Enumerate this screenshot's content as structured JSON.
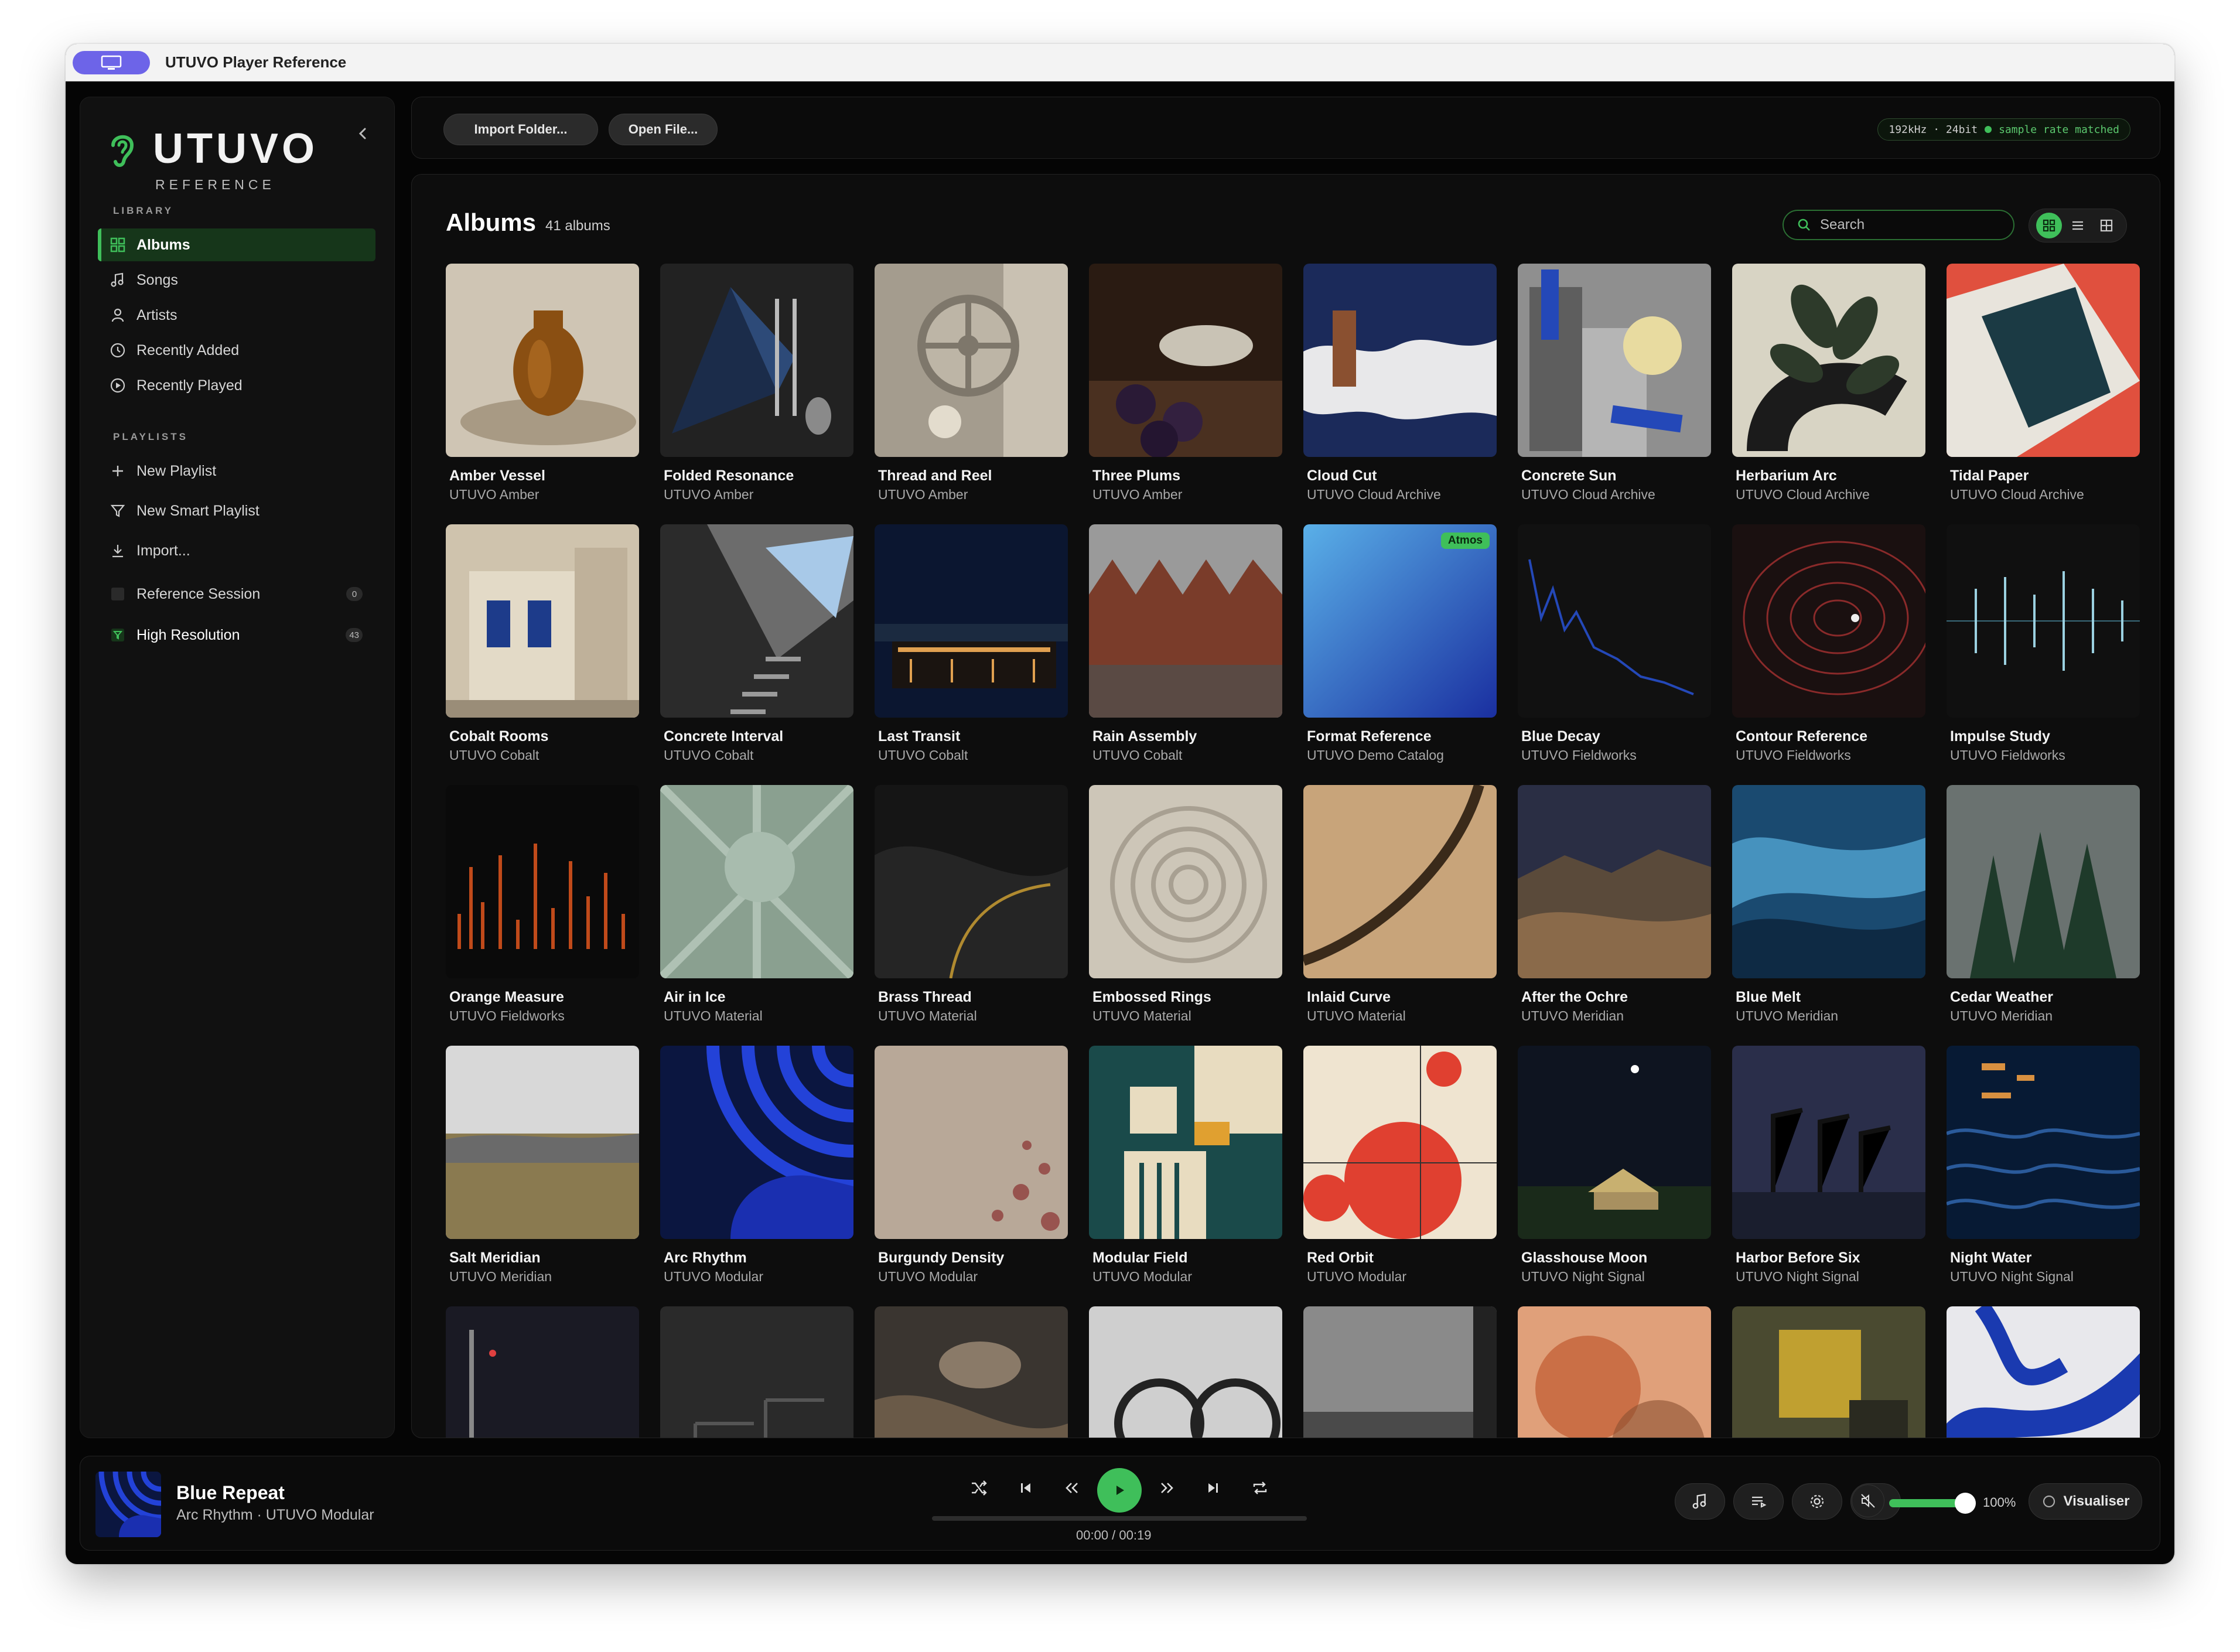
{
  "window": {
    "title": "UTUVO Player Reference"
  },
  "sidebar": {
    "logo_name": "UTUVO",
    "logo_sub": "REFERENCE",
    "library_label": "LIBRARY",
    "library": [
      {
        "label": "Albums",
        "icon": "grid-icon"
      },
      {
        "label": "Songs",
        "icon": "music-note-icon"
      },
      {
        "label": "Artists",
        "icon": "person-icon"
      },
      {
        "label": "Recently Added",
        "icon": "clock-icon"
      },
      {
        "label": "Recently Played",
        "icon": "play-circle-icon"
      }
    ],
    "playlists_label": "PLAYLISTS",
    "playlist_actions": [
      {
        "label": "New Playlist",
        "icon": "plus-icon"
      },
      {
        "label": "New Smart Playlist",
        "icon": "filter-icon"
      },
      {
        "label": "Import...",
        "icon": "download-icon"
      }
    ],
    "playlists": [
      {
        "label": "Reference Session",
        "count": "0"
      },
      {
        "label": "High Resolution",
        "count": "43"
      }
    ]
  },
  "toolbar": {
    "import_folder": "Import Folder...",
    "open_file": "Open File...",
    "rate": "192kHz · 24bit",
    "rate_status": "sample rate matched"
  },
  "albums_view": {
    "title": "Albums",
    "count": "41 albums",
    "search_placeholder": "Search",
    "badge_atmos": "Atmos",
    "albums": [
      {
        "title": "Amber Vessel",
        "artist": "UTUVO Amber"
      },
      {
        "title": "Folded Resonance",
        "artist": "UTUVO Amber"
      },
      {
        "title": "Thread and Reel",
        "artist": "UTUVO Amber"
      },
      {
        "title": "Three Plums",
        "artist": "UTUVO Amber"
      },
      {
        "title": "Cloud Cut",
        "artist": "UTUVO Cloud Archive"
      },
      {
        "title": "Concrete Sun",
        "artist": "UTUVO Cloud Archive"
      },
      {
        "title": "Herbarium Arc",
        "artist": "UTUVO Cloud Archive"
      },
      {
        "title": "Tidal Paper",
        "artist": "UTUVO Cloud Archive"
      },
      {
        "title": "Cobalt Rooms",
        "artist": "UTUVO Cobalt"
      },
      {
        "title": "Concrete Interval",
        "artist": "UTUVO Cobalt"
      },
      {
        "title": "Last Transit",
        "artist": "UTUVO Cobalt"
      },
      {
        "title": "Rain Assembly",
        "artist": "UTUVO Cobalt"
      },
      {
        "title": "Format Reference",
        "artist": "UTUVO Demo Catalog"
      },
      {
        "title": "Blue Decay",
        "artist": "UTUVO Fieldworks"
      },
      {
        "title": "Contour Reference",
        "artist": "UTUVO Fieldworks"
      },
      {
        "title": "Impulse Study",
        "artist": "UTUVO Fieldworks"
      },
      {
        "title": "Orange Measure",
        "artist": "UTUVO Fieldworks"
      },
      {
        "title": "Air in Ice",
        "artist": "UTUVO Material"
      },
      {
        "title": "Brass Thread",
        "artist": "UTUVO Material"
      },
      {
        "title": "Embossed Rings",
        "artist": "UTUVO Material"
      },
      {
        "title": "Inlaid Curve",
        "artist": "UTUVO Material"
      },
      {
        "title": "After the Ochre",
        "artist": "UTUVO Meridian"
      },
      {
        "title": "Blue Melt",
        "artist": "UTUVO Meridian"
      },
      {
        "title": "Cedar Weather",
        "artist": "UTUVO Meridian"
      },
      {
        "title": "Salt Meridian",
        "artist": "UTUVO Meridian"
      },
      {
        "title": "Arc Rhythm",
        "artist": "UTUVO Modular"
      },
      {
        "title": "Burgundy Density",
        "artist": "UTUVO Modular"
      },
      {
        "title": "Modular Field",
        "artist": "UTUVO Modular"
      },
      {
        "title": "Red Orbit",
        "artist": "UTUVO Modular"
      },
      {
        "title": "Glasshouse Moon",
        "artist": "UTUVO Night Signal"
      },
      {
        "title": "Harbor Before Six",
        "artist": "UTUVO Night Signal"
      },
      {
        "title": "Night Water",
        "artist": "UTUVO Night Signal"
      }
    ]
  },
  "player": {
    "title": "Blue Repeat",
    "subtitle": "Arc Rhythm · UTUVO Modular",
    "time": "00:00 / 00:19",
    "progress": 0,
    "volume": "100%",
    "volume_fraction": 1.0,
    "visualiser": "Visualiser"
  },
  "colors": {
    "accent": "#3fbf5a",
    "background": "#050505",
    "panel": "#0d0d0d"
  }
}
